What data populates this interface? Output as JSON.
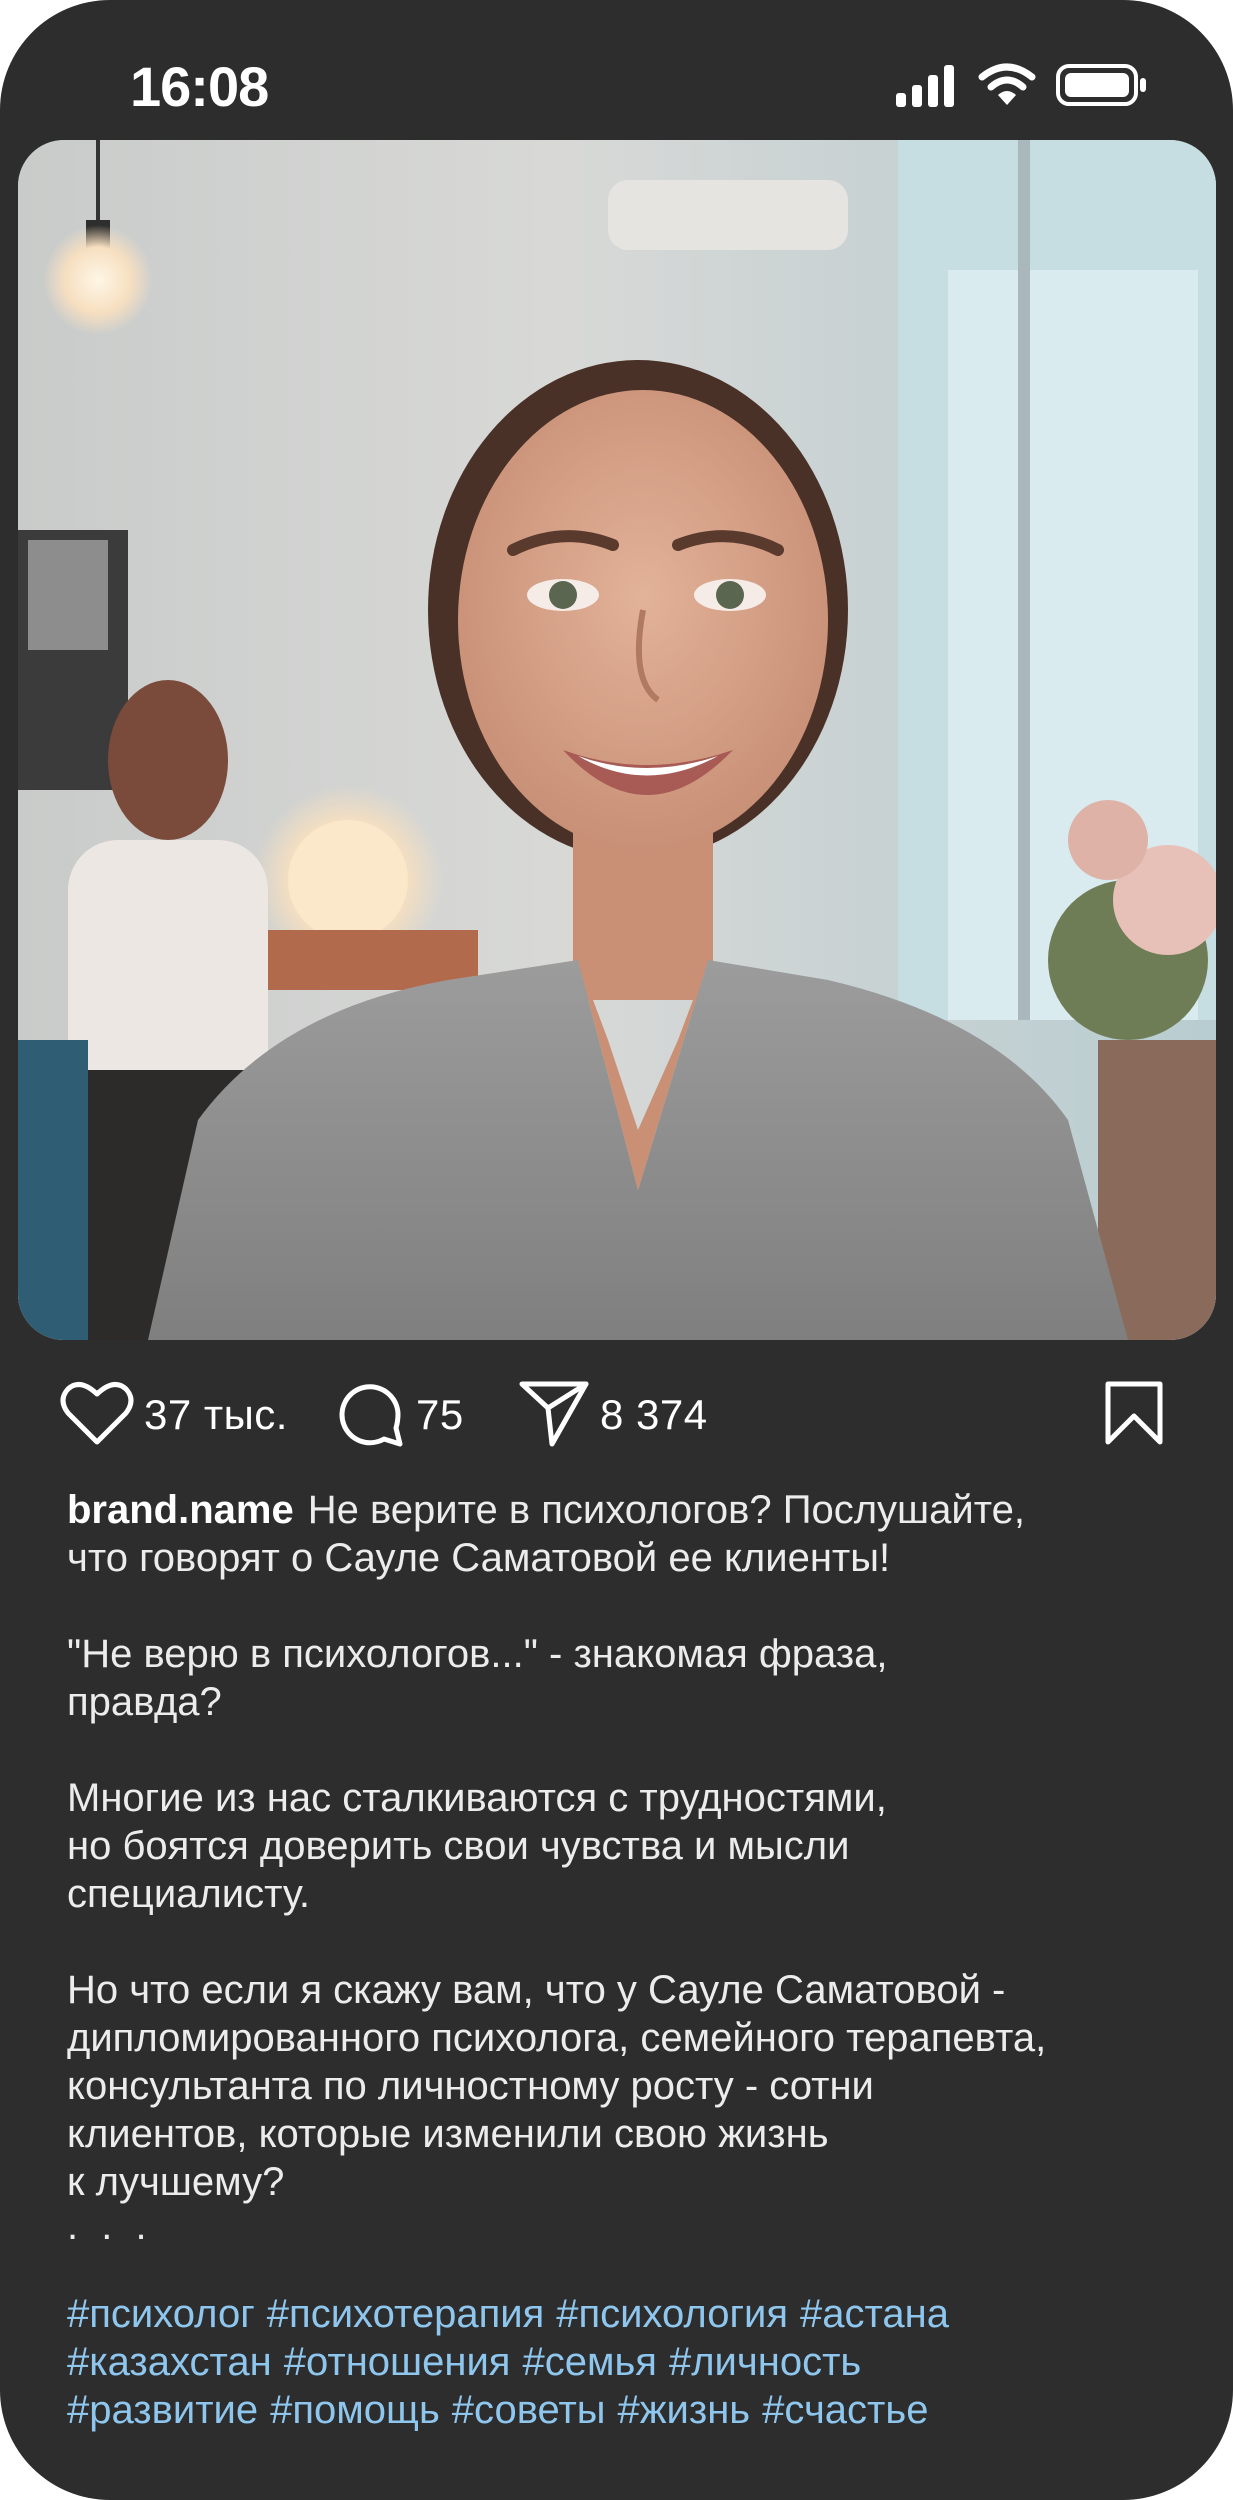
{
  "status_bar": {
    "time": "16:08"
  },
  "post": {
    "icons": {
      "like": "heart-icon",
      "comment": "comment-icon",
      "share": "paper-plane-icon",
      "save": "bookmark-icon"
    },
    "likes": "37 тыс.",
    "comments": "75",
    "shares": "8 374",
    "username": "brand.name",
    "caption_first": "Не верите в психологов? Послушайте,",
    "caption_lines": [
      "что говорят о Сауле Саматовой ее клиенты!"
    ],
    "paragraph2": [
      "\"Не верю в психологов...\" - знакомая фраза,",
      "правда?"
    ],
    "paragraph3": [
      "Многие из нас сталкиваются с трудностями,",
      "но боятся доверить свои чувства и мысли",
      "специалисту."
    ],
    "paragraph4": [
      "Но что если я скажу вам, что у Сауле Саматовой -",
      "дипломированного психолога, семейного терапевта,",
      "консультанта по личностному росту - сотни",
      "клиентов, которые изменили свою жизнь",
      "к лучшему?"
    ],
    "ellipsis": ". . .",
    "hashtags_rows": [
      [
        "#психолог",
        "#психотерапия",
        "#психология",
        "#астана"
      ],
      [
        "#казахстан",
        "#отношения",
        "#семья",
        "#личность"
      ],
      [
        "#развитие",
        "#помощь",
        "#советы",
        "#жизнь",
        "#счастье"
      ]
    ]
  },
  "colors": {
    "background": "#2d2d2d",
    "hashtag": "#8fc6ee",
    "text": "#ececec"
  }
}
